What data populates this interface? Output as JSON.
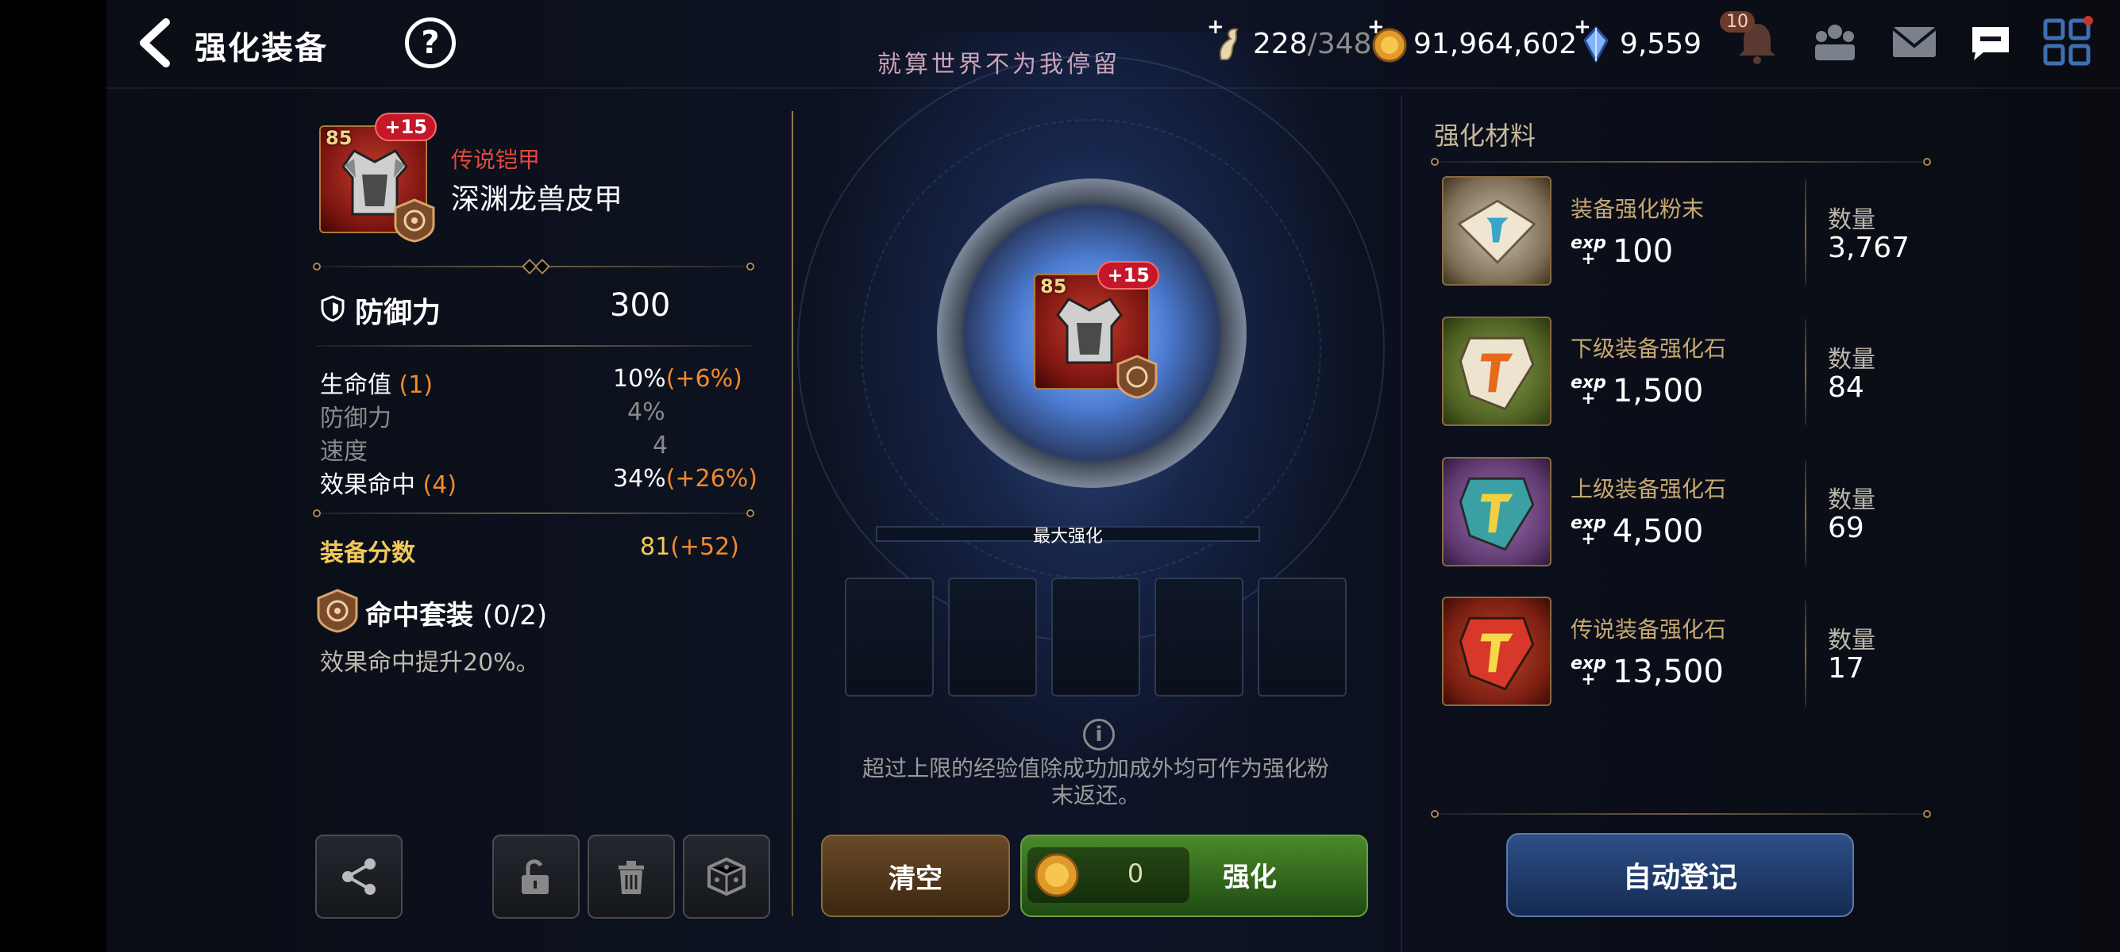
{
  "header": {
    "title": "强化装备",
    "banner": "就算世界不为我停留",
    "stamina_current": "228",
    "stamina_max": "/348",
    "gold": "91,964,602",
    "crystals": "9,559",
    "notification_count": "10"
  },
  "item": {
    "level": "85",
    "enhance": "+15",
    "grade": "传说铠甲",
    "name": "深渊龙兽皮甲",
    "main_stat_label": "防御力",
    "main_stat_value": "300",
    "substats": [
      {
        "label": "生命值",
        "roll": "(1)",
        "value": "10%",
        "bonus": "(+6%)"
      },
      {
        "label": "防御力",
        "roll": "",
        "value": "4%",
        "bonus": ""
      },
      {
        "label": "速度",
        "roll": "",
        "value": "4",
        "bonus": ""
      },
      {
        "label": "效果命中",
        "roll": "(4)",
        "value": "34%",
        "bonus": "(+26%)"
      }
    ],
    "score_label": "装备分数",
    "score_value": "81",
    "score_bonus": "(+52)",
    "set_name": "命中套装",
    "set_count": "(0/2)",
    "set_desc": "效果命中提升20%。"
  },
  "center": {
    "max_label": "最大强化",
    "info_text_line1": "超过上限的经验值除成功加成外均可作为强化粉",
    "info_text_line2": "末返还。",
    "clear_label": "清空",
    "enhance_label": "强化",
    "enhance_cost": "0"
  },
  "materials": {
    "title": "强化材料",
    "qty_label": "数量",
    "exp_tag": "exp",
    "items": [
      {
        "name": "装备强化粉末",
        "exp": "100",
        "qty": "3,767"
      },
      {
        "name": "下级装备强化石",
        "exp": "1,500",
        "qty": "84"
      },
      {
        "name": "上级装备强化石",
        "exp": "4,500",
        "qty": "69"
      },
      {
        "name": "传说装备强化石",
        "exp": "13,500",
        "qty": "17"
      }
    ],
    "auto_label": "自动登记"
  },
  "colors": {
    "accent_orange": "#f08a2c",
    "accent_gold": "#f2c95a",
    "legend_red": "#e04a3c",
    "material_gold": "#c7a873"
  }
}
